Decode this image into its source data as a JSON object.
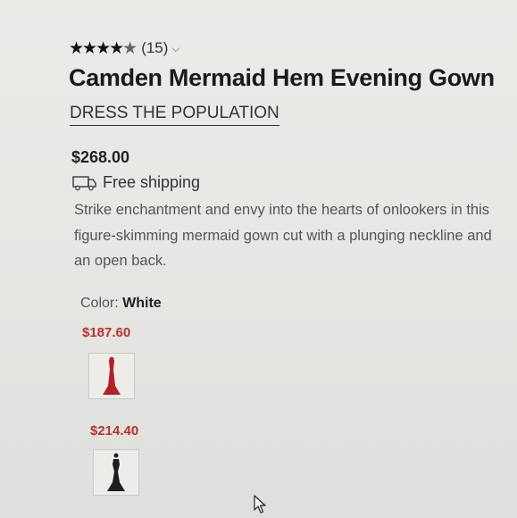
{
  "rating": {
    "stars_icon": "star-rating-icon",
    "count": "(15)"
  },
  "product": {
    "title": "Camden Mermaid Hem Evening Gown",
    "brand": "DRESS THE POPULATION",
    "price": "$268.00",
    "shipping": "Free shipping",
    "description": "Strike enchantment and envy into the hearts of onlookers in this figure-skimming mermaid gown cut with a plunging neckline and an open back."
  },
  "color": {
    "label": "Color:",
    "value": "White"
  },
  "swatches": [
    {
      "price": "$187.60",
      "color": "#b3212b"
    },
    {
      "price": "$214.40",
      "color": "#1e1e1e"
    }
  ]
}
